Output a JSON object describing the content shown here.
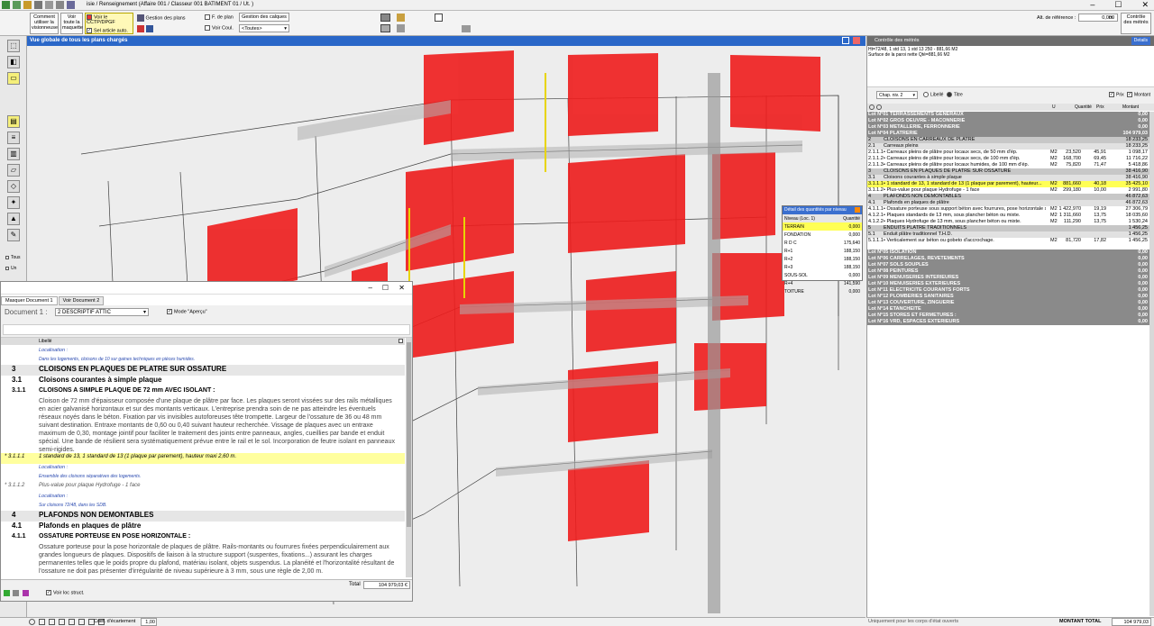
{
  "titlebar": {
    "breadcrumb": "isie / Renseignement  (Affaire 001 / Classeur 001 BATIMENT 01 / Ut. )",
    "minimize": "–",
    "maximize": "☐",
    "close": "✕"
  },
  "ribbon": {
    "btn_comment": "Comment utiliser la visionneuse",
    "btn_voir_toute": "Voir toute la maquette",
    "chk_voir_cctp": "Voir le CCTP/DPGF",
    "chk_sel_article": "Sel article auto.",
    "gestion_plans": "Gestion des plans",
    "chk_fdeplan": "F. de plan",
    "gestion_calques": "Gestion des calques",
    "chk_voir_coul": "Voir Coul.",
    "select_toutes": "<Toutes>",
    "alt_ref_label": "Alt. de référence :",
    "alt_ref_value": "0,000",
    "alt_ref_unit": "m",
    "btn_controle": "Contrôle des métrés"
  },
  "view": {
    "title": "Vue globale de tous les plans chargés"
  },
  "left_toolbar": {
    "tous": "Tous",
    "un": "Un"
  },
  "detail_panel": {
    "title": "Détail des quantités par niveau",
    "col_niveau": "Niveau (Loc. 1)",
    "col_quantite": "Quantité",
    "rows": [
      {
        "niveau": "TERRAIN",
        "quantite": "0,000"
      },
      {
        "niveau": "FONDATION",
        "quantite": "0,000"
      },
      {
        "niveau": "R D C",
        "quantite": "175,640"
      },
      {
        "niveau": "R+1",
        "quantite": "188,150"
      },
      {
        "niveau": "R+2",
        "quantite": "188,150"
      },
      {
        "niveau": "R+3",
        "quantite": "188,150"
      },
      {
        "niveau": "SOUS-SOL",
        "quantite": "0,000"
      },
      {
        "niveau": "R+4",
        "quantite": "141,590"
      },
      {
        "niveau": "TOITURE",
        "quantite": "0,000"
      }
    ]
  },
  "doc_window": {
    "tab1": "Masquer Document 1",
    "tab2": "Voir Document 2",
    "doc_label": "Document 1 :",
    "doc_select": "2  DESCRIPTIF ATTIC",
    "mode_apercu": "Mode \"Aperçu\"",
    "col_libelle": "Libellé",
    "total_label": "Total",
    "total_value": "104 979,03 €",
    "voir_loc": "Voir loc struct.",
    "rows": [
      {
        "num": "",
        "text": "Localisation :",
        "style": "loc"
      },
      {
        "num": "",
        "text": "Dans les logements, cloisons de 10 sur gaines techniques en pièces humides.",
        "style": "small"
      },
      {
        "num": "3",
        "text": "CLOISONS EN PLAQUES DE PLATRE SUR OSSATURE",
        "style": "h1"
      },
      {
        "num": "3.1",
        "text": "Cloisons courantes à simple plaque",
        "style": "h2"
      },
      {
        "num": "3.1.1",
        "text": "CLOISONS A SIMPLE PLAQUE DE 72 mm AVEC ISOLANT :",
        "style": "h3"
      },
      {
        "num": "",
        "text": "Cloison de 72 mm d'épaisseur composée d'une plaque de plâtre par face. Les plaques seront vissées sur des rails métalliques en acier galvanisé horizontaux et sur des montants verticaux. L'entreprise prendra soin de ne pas atteindre les éventuels réseaux noyés dans le béton. Fixation par vis invisibles autoforeuses tête trompette. Largeur de l'ossature de 36 ou 48 mm suivant destination. Entraxe montants de 0,60 ou 0,40 suivant hauteur recherchée. Vissage de plaques avec un entraxe maximum de 0,30, montage jointif pour faciliter le traitement des joints entre panneaux, angles, cueillies par bande et enduit spécial. Une bande de résilient sera systématiquement prévue entre le rail et le sol. Incorporation de feutre isolant en panneaux semi-rigides.",
        "style": "para"
      },
      {
        "num": "* 3.1.1.1",
        "text": "1 standard de 13, 1 standard de 13 (1 plaque par parement), hauteur maxi 2,60 m.",
        "style": "item-hl"
      },
      {
        "num": "",
        "text": "Localisation :",
        "style": "loc"
      },
      {
        "num": "",
        "text": "Ensemble des cloisons séparatives des logements.",
        "style": "small"
      },
      {
        "num": "* 3.1.1.2",
        "text": "Plus-value pour plaque Hydrofuge - 1 face",
        "style": "item"
      },
      {
        "num": "",
        "text": "Localisation :",
        "style": "loc"
      },
      {
        "num": "",
        "text": "Sur cloisons 72/48, dans les SDB.",
        "style": "small"
      },
      {
        "num": "4",
        "text": "PLAFONDS NON DEMONTABLES",
        "style": "h1"
      },
      {
        "num": "4.1",
        "text": "Plafonds en plaques de plâtre",
        "style": "h2"
      },
      {
        "num": "4.1.1",
        "text": "OSSATURE PORTEUSE EN POSE HORIZONTALE :",
        "style": "h3"
      },
      {
        "num": "",
        "text": "Ossature porteuse pour la pose horizontale de plaques de plâtre. Rails-montants ou fourrures fixées perpendiculairement aux grandes longueurs de plaques. Dispositifs de liaison à la structure support (suspentes, fixations...) assurant les charges permanentes telles que le poids propre du plafond, matériau isolant, objets suspendus. La planéité et l'horizontalité résultant de l'ossature ne doit pas présenter d'irrégularité de niveau supérieure à 3 mm, sous une règle de 2,00 m.",
        "style": "para2"
      }
    ]
  },
  "bottom": {
    "coef_label": "Coef. d'écartement",
    "coef_value": "1,00"
  },
  "right_panel": {
    "header": "Contrôle des métrés",
    "details_btn": "Details",
    "formula": "Ht=72/48, 1 std 13, 1 std 13 250 - 881,66 M2",
    "formula2": "Surface de la paroi nette    Qté=881,66 M2",
    "chap_label": "Chap. niv. 2",
    "libelle_label": "Libellé",
    "titre_label": "Titre",
    "prix_label": "Prix",
    "montant_label": "Montant",
    "col_u": "U",
    "col_quantite": "Quantité",
    "col_prix": "Prix",
    "col_montant": "Montant",
    "rows": [
      {
        "type": "lot",
        "code": "",
        "label": "Lot N°01 TERRASSEMENTS GENERAUX",
        "u": "",
        "q": "",
        "p": "",
        "m": "0,00"
      },
      {
        "type": "lot",
        "code": "",
        "label": "Lot N°02 GROS OEUVRE - MACONNERIE",
        "u": "",
        "q": "",
        "p": "",
        "m": "0,00"
      },
      {
        "type": "lot",
        "code": "",
        "label": "Lot N°03 METALLERIE, FERRONNERIE",
        "u": "",
        "q": "",
        "p": "",
        "m": "0,00"
      },
      {
        "type": "lot",
        "code": "",
        "label": "Lot N°04 PLATRERIE",
        "u": "",
        "q": "",
        "p": "",
        "m": "104 979,03"
      },
      {
        "type": "sec",
        "code": "2",
        "label": "CLOISONS EN CARREAUX DE PLATRE",
        "u": "",
        "q": "",
        "p": "",
        "m": "18 233,25"
      },
      {
        "type": "sec2",
        "code": "2.1",
        "label": "Carreaux pleins",
        "u": "",
        "q": "",
        "p": "",
        "m": "18 233,25"
      },
      {
        "type": "item",
        "code": "2.1.1.1",
        "label": "• Carreaux pleins de plâtre pour locaux secs, de 50 mm d'ép.",
        "u": "M2",
        "q": "23,520",
        "p": "45,91",
        "m": "1 098,17"
      },
      {
        "type": "item",
        "code": "2.1.1.2",
        "label": "• Carreaux pleins de plâtre pour locaux secs, de 100 mm d'ép.",
        "u": "M2",
        "q": "168,700",
        "p": "69,45",
        "m": "11 716,22"
      },
      {
        "type": "item",
        "code": "2.1.1.3",
        "label": "• Carreaux pleins de plâtre pour locaux humides, de 100 mm d'ép.",
        "u": "M2",
        "q": "75,820",
        "p": "71,47",
        "m": "5 418,86"
      },
      {
        "type": "sec",
        "code": "3",
        "label": "CLOISONS EN PLAQUES DE PLATRE SUR OSSATURE",
        "u": "",
        "q": "",
        "p": "",
        "m": "38 416,90"
      },
      {
        "type": "sec2",
        "code": "3.1",
        "label": "Cloisons courantes à simple plaque",
        "u": "",
        "q": "",
        "p": "",
        "m": "38 416,90"
      },
      {
        "type": "hl",
        "code": "3.1.1.1",
        "label": "• 1 standard de 13, 1 standard de 13 (1 plaque par parement), hauteur...",
        "u": "M2",
        "q": "881,660",
        "p": "40,18",
        "m": "35 425,10"
      },
      {
        "type": "item",
        "code": "3.1.1.2",
        "label": "• Plus-value pour plaque Hydrofuge - 1 face",
        "u": "M2",
        "q": "299,180",
        "p": "10,00",
        "m": "2 991,80"
      },
      {
        "type": "sec",
        "code": "4",
        "label": "PLAFONDS NON DEMONTABLES",
        "u": "",
        "q": "",
        "p": "",
        "m": "46 872,63"
      },
      {
        "type": "sec2",
        "code": "4.1",
        "label": "Plafonds en plaques de plâtre",
        "u": "",
        "q": "",
        "p": "",
        "m": "46 872,63"
      },
      {
        "type": "item",
        "code": "4.1.1.1",
        "label": "• Ossature porteuse sous support béton avec fourrures, pose horizontale sous d...",
        "u": "M2",
        "q": "1 422,970",
        "p": "19,19",
        "m": "27 306,79"
      },
      {
        "type": "item",
        "code": "4.1.2.1",
        "label": "• Plaques standards de 13 mm, sous plancher béton ou mixte.",
        "u": "M2",
        "q": "1 311,660",
        "p": "13,75",
        "m": "18 035,60"
      },
      {
        "type": "item",
        "code": "4.1.2.2",
        "label": "• Plaques Hydrofuge de 13 mm, sous plancher béton ou mixte.",
        "u": "M2",
        "q": "111,290",
        "p": "13,75",
        "m": "1 530,24"
      },
      {
        "type": "sec",
        "code": "5",
        "label": "ENDUITS PLATRE TRADITIONNELS",
        "u": "",
        "q": "",
        "p": "",
        "m": "1 456,25"
      },
      {
        "type": "sec2",
        "code": "5.1",
        "label": "Enduit plâtre traditionnel T.H.D.",
        "u": "",
        "q": "",
        "p": "",
        "m": "1 456,25"
      },
      {
        "type": "item",
        "code": "5.1.1.1",
        "label": "• Verticalement sur béton ou gobeto d'accrochage.",
        "u": "M2",
        "q": "81,720",
        "p": "17,82",
        "m": "1 456,25"
      },
      {
        "type": "gap",
        "code": "",
        "label": "",
        "u": "",
        "q": "",
        "p": "",
        "m": ""
      },
      {
        "type": "lot",
        "code": "",
        "label": "Lot N°05 ISOLATION",
        "u": "",
        "q": "",
        "p": "",
        "m": "0,00"
      },
      {
        "type": "lot",
        "code": "",
        "label": "Lot N°06 CARRELAGES, REVETEMENTS",
        "u": "",
        "q": "",
        "p": "",
        "m": "0,00"
      },
      {
        "type": "lot",
        "code": "",
        "label": "Lot N°07 SOLS SOUPLES",
        "u": "",
        "q": "",
        "p": "",
        "m": "0,00"
      },
      {
        "type": "lot",
        "code": "",
        "label": "Lot N°08 PEINTURES",
        "u": "",
        "q": "",
        "p": "",
        "m": "0,00"
      },
      {
        "type": "lot",
        "code": "",
        "label": "Lot N°09 MENUISERIES INTERIEURES",
        "u": "",
        "q": "",
        "p": "",
        "m": "0,00"
      },
      {
        "type": "lot",
        "code": "",
        "label": "Lot N°10 MENUISERIES EXTERIEURES",
        "u": "",
        "q": "",
        "p": "",
        "m": "0,00"
      },
      {
        "type": "lot",
        "code": "",
        "label": "Lot N°11 ELECTRICITE COURANTS FORTS",
        "u": "",
        "q": "",
        "p": "",
        "m": "0,00"
      },
      {
        "type": "lot",
        "code": "",
        "label": "Lot N°12 PLOMBERIES SANITAIRES",
        "u": "",
        "q": "",
        "p": "",
        "m": "0,00"
      },
      {
        "type": "lot",
        "code": "",
        "label": "Lot N°13 COUVERTURE, ZINGUERIE",
        "u": "",
        "q": "",
        "p": "",
        "m": "0,00"
      },
      {
        "type": "lot",
        "code": "",
        "label": "Lot N°14 ETANCHEITE",
        "u": "",
        "q": "",
        "p": "",
        "m": "0,00"
      },
      {
        "type": "lot",
        "code": "",
        "label": "Lot N°15 STORES ET FERMETURES :",
        "u": "",
        "q": "",
        "p": "",
        "m": "0,00"
      },
      {
        "type": "lot",
        "code": "",
        "label": "Lot N°16 VRD, ESPACES EXTERIEURS",
        "u": "",
        "q": "",
        "p": "",
        "m": "0,00"
      }
    ],
    "footer_left": "Uniquement pour les corps d'état ouverts",
    "footer_total_label": "MONTANT TOTAL",
    "footer_total_value": "104 979,03"
  },
  "colors": {
    "accent": "#2a67c8",
    "wall_red": "#ee1c1c",
    "highlight": "#ffff55",
    "lot_bg": "#8a8a8a"
  }
}
